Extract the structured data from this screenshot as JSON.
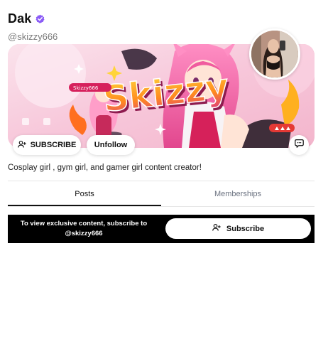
{
  "profile": {
    "display_name": "Dak",
    "handle": "@skizzy666",
    "bio": "Cosplay girl , gym girl, and gamer girl content creator!",
    "verified_color": "#8b5cf6"
  },
  "banner": {
    "logo_text": "Skizzy",
    "tag_text": "Skizzy666"
  },
  "actions": {
    "subscribe_label": "SUBSCRIBE",
    "unfollow_label": "Unfollow"
  },
  "tabs": [
    {
      "label": "Posts",
      "active": true
    },
    {
      "label": "Memberships",
      "active": false
    }
  ],
  "promo": {
    "message": "To view exclusive content, subscribe to @skizzy666",
    "button_label": "Subscribe"
  },
  "icons": {
    "verified": "verified-badge-icon",
    "person_add": "person-add-icon",
    "chat": "chat-bubble-icon"
  },
  "colors": {
    "banner_pink": "#f6c6d8",
    "logo_orange": "#ff7a1a",
    "logo_magenta": "#c2185b",
    "promo_bg": "#000000"
  }
}
